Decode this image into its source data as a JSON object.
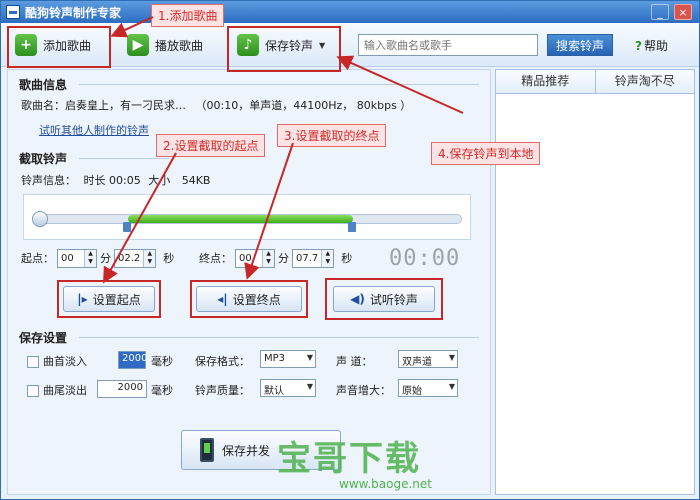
{
  "window": {
    "title": "酷狗铃声制作专家",
    "minimize": "_",
    "close": "×"
  },
  "toolbar": {
    "add_song": "添加歌曲",
    "play_song": "播放歌曲",
    "save_ringtone": "保存铃声",
    "search_placeholder": "输入歌曲名或歌手",
    "search_button": "搜索铃声",
    "help": "帮助"
  },
  "right_panel": {
    "tabs": [
      "精品推荐",
      "铃声淘不尽"
    ]
  },
  "song_info": {
    "section_title": "歌曲信息",
    "label": "歌曲名：",
    "name": "启奏皇上，有一刁民求…",
    "details": "（00:10，单声道，44100Hz，  80kbps ）",
    "try_link": "试听其他人制作的铃声"
  },
  "capture": {
    "section_title": "截取铃声",
    "info_label": "铃声信息：",
    "duration_label": "时长",
    "duration": "00:05",
    "size_label": "大小",
    "size": "54KB",
    "selection_start": 0.21,
    "selection_end": 0.74,
    "start_label": "起点：",
    "start_min": "00",
    "start_sec": "02.2",
    "end_label": "终点：",
    "end_min": "00",
    "end_sec": "07.7",
    "min_unit": "分",
    "sec_unit": "秒",
    "lcd": "00:00",
    "set_start": "设置起点",
    "set_end": "设置终点",
    "preview": "试听铃声"
  },
  "save_settings": {
    "section_title": "保存设置",
    "fade_in_label": "曲首淡入",
    "fade_in_value": "2000",
    "fade_out_label": "曲尾淡出",
    "fade_out_value": "2000",
    "ms_unit": "毫秒",
    "format_label": "保存格式：",
    "format_value": "MP3",
    "quality_label": "铃声质量：",
    "quality_value": "默认",
    "channel_label": "声    道：",
    "channel_value": "双声道",
    "volume_label": "声音增大：",
    "volume_value": "原始",
    "save_send": "保存并发"
  },
  "annotations": {
    "step1": "1.添加歌曲",
    "step2": "2.设置截取的起点",
    "step3": "3.设置截取的终点",
    "step4": "4.保存铃声到本地"
  },
  "watermark": {
    "text": "宝哥下载",
    "url": "www.baoge.net"
  },
  "colors": {
    "accent": "#2d6cc0",
    "annotation_red": "#c62828",
    "selection_green": "#3dad19",
    "watermark_green": "#4fb24f"
  }
}
